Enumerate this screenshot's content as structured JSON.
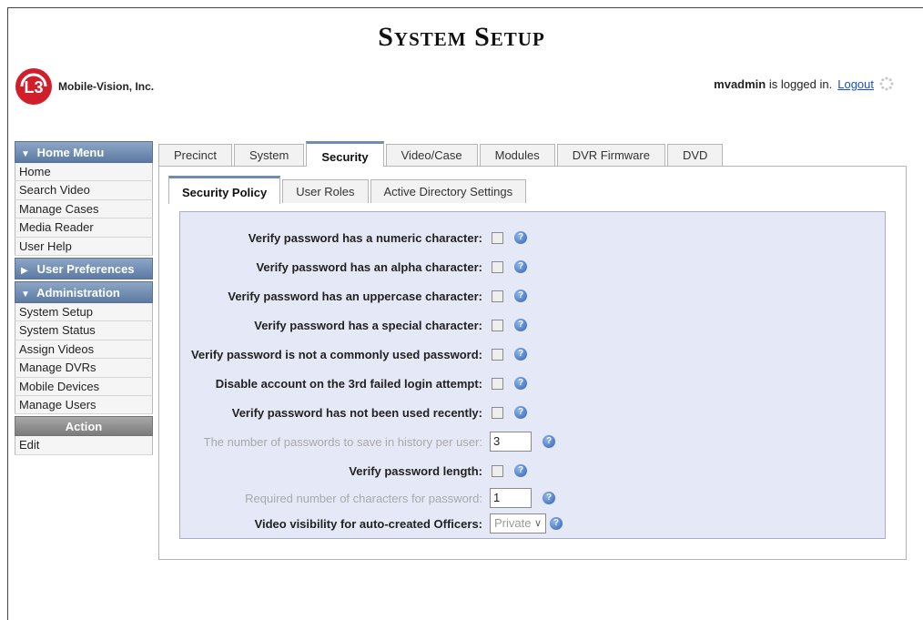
{
  "header": {
    "title": "System Setup",
    "company": "Mobile-Vision, Inc.",
    "logo_text": "L3",
    "username": "mvadmin",
    "logged_in_text": " is logged in.",
    "logout_label": "Logout"
  },
  "sidebar": {
    "home_menu": {
      "label": "Home Menu",
      "items": [
        "Home",
        "Search Video",
        "Manage Cases",
        "Media Reader",
        "User Help"
      ]
    },
    "user_preferences": {
      "label": "User Preferences"
    },
    "administration": {
      "label": "Administration",
      "items": [
        "System Setup",
        "System Status",
        "Assign Videos",
        "Manage DVRs",
        "Mobile Devices",
        "Manage Users"
      ]
    },
    "action": {
      "label": "Action",
      "items": [
        "Edit"
      ]
    }
  },
  "tabs": [
    "Precinct",
    "System",
    "Security",
    "Video/Case",
    "Modules",
    "DVR Firmware",
    "DVD"
  ],
  "active_tab": "Security",
  "subtabs": [
    "Security Policy",
    "User Roles",
    "Active Directory Settings"
  ],
  "active_subtab": "Security Policy",
  "form": {
    "numeric": "Verify password has a numeric character:",
    "alpha": "Verify password has an alpha character:",
    "uppercase": "Verify password has an uppercase character:",
    "special": "Verify password has a special character:",
    "common": "Verify password is not a commonly used password:",
    "disable": "Disable account on the 3rd failed login attempt:",
    "recent": "Verify password has not been used recently:",
    "history_label": "The number of passwords to save in history per user:",
    "history_value": "3",
    "length_check": "Verify password length:",
    "length_label": "Required number of characters for password:",
    "length_value": "1",
    "visibility_label": "Video visibility for auto-created Officers:",
    "visibility_value": "Private"
  },
  "colors": {
    "sidebar_header": "#6f8cb3",
    "form_background": "#e5e8f6",
    "logo_red": "#d01f2a",
    "link": "#1a4fbf"
  }
}
